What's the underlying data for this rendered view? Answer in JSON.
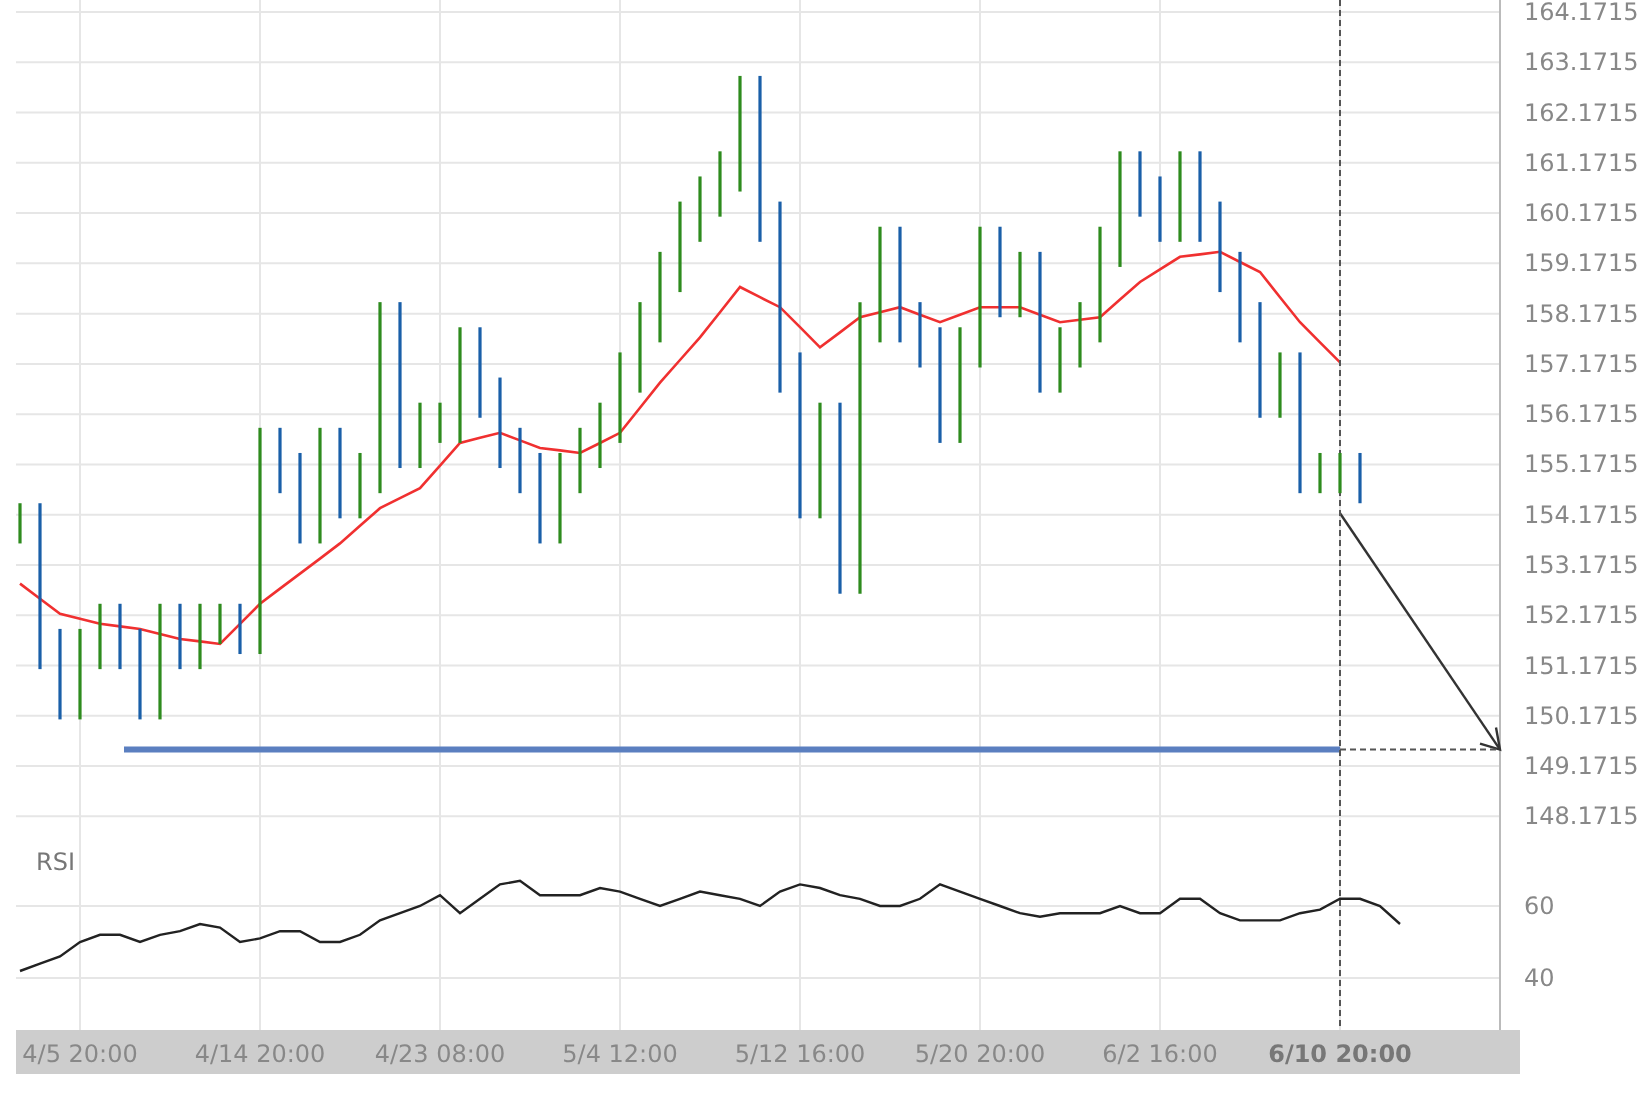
{
  "price_chart": {
    "chart_data": {
      "type": "line",
      "grid": true,
      "ylim": [
        147.9,
        164.41
      ],
      "categories": [
        null,
        null,
        null,
        null,
        null,
        null,
        null,
        null,
        null,
        null,
        null,
        null,
        null,
        null,
        null,
        null,
        null,
        null,
        null,
        null,
        null,
        null,
        null,
        null,
        null,
        null,
        null,
        null,
        null,
        null,
        null,
        null,
        null,
        null,
        null,
        null,
        null,
        null,
        null,
        null,
        null,
        null,
        null,
        null,
        null,
        null,
        null,
        null,
        null,
        null,
        null,
        null,
        null,
        null,
        null,
        null,
        null,
        null,
        null,
        null,
        null,
        null,
        null,
        null,
        null,
        null,
        null
      ],
      "yticks": [
        {
          "value": 164.1715,
          "label": "164.1715"
        },
        {
          "value": 163.1715,
          "label": "163.1715"
        },
        {
          "value": 162.1715,
          "label": "162.1715"
        },
        {
          "value": 161.1715,
          "label": "161.1715"
        },
        {
          "value": 160.1715,
          "label": "160.1715"
        },
        {
          "value": 159.1715,
          "label": "159.1715"
        },
        {
          "value": 158.1715,
          "label": "158.1715"
        },
        {
          "value": 157.1715,
          "label": "157.1715"
        },
        {
          "value": 156.1715,
          "label": "156.1715"
        },
        {
          "value": 155.1715,
          "label": "155.1715"
        },
        {
          "value": 154.1715,
          "label": "154.1715"
        },
        {
          "value": 153.1715,
          "label": "153.1715"
        },
        {
          "value": 152.1715,
          "label": "152.1715"
        },
        {
          "value": 151.1715,
          "label": "151.1715"
        },
        {
          "value": 150.1715,
          "label": "150.1715"
        },
        {
          "value": 149.1715,
          "label": "149.1715"
        },
        {
          "value": 148.1715,
          "label": "148.1715"
        }
      ],
      "series": [
        {
          "color": "#f03030",
          "values": [
            152.8,
            152.5,
            152.2,
            152.1,
            152,
            151.95,
            151.9,
            151.8,
            151.7,
            151.65,
            151.6,
            152,
            152.4,
            152.7,
            153,
            153.3,
            153.6,
            153.95,
            154.3,
            154.5,
            154.7,
            155.15,
            155.6,
            155.7,
            155.8,
            155.65,
            155.5,
            155.45,
            155.4,
            155.6,
            155.8,
            156.3,
            156.8,
            157.25,
            157.7,
            158.2,
            158.7,
            158.5,
            158.3,
            157.9,
            157.5,
            157.8,
            158.1,
            158.2,
            158.3,
            158.15,
            158,
            158.15,
            158.3,
            158.3,
            158.3,
            158.15,
            158,
            158.05,
            158.1,
            158.45,
            158.8,
            159.05,
            159.3,
            159.35,
            159.4,
            159.2,
            159,
            158.5,
            158,
            157.6,
            157.2
          ]
        }
      ],
      "ref_lines": [
        {
          "axis": "y",
          "value": 149.5,
          "color": "#5b7fc0"
        }
      ]
    }
  },
  "rsi_chart": {
    "chart_data": {
      "type": "line",
      "title": "RSI",
      "grid": true,
      "ylim": [
        25.6,
        81.1
      ],
      "categories": [
        null,
        null,
        null,
        "4/5 20:00",
        null,
        null,
        null,
        null,
        null,
        null,
        null,
        null,
        "4/14 20:00",
        null,
        null,
        null,
        null,
        null,
        null,
        null,
        null,
        "4/23 08:00",
        null,
        null,
        null,
        null,
        null,
        null,
        null,
        null,
        "5/4 12:00",
        null,
        null,
        null,
        null,
        null,
        null,
        null,
        null,
        "5/12 16:00",
        null,
        null,
        null,
        null,
        null,
        null,
        null,
        null,
        "5/20 20:00",
        null,
        null,
        null,
        null,
        null,
        null,
        null,
        null,
        "6/2 16:00",
        null,
        null,
        null,
        null,
        null,
        null,
        null,
        null,
        "6/10 20:00",
        null,
        null,
        null
      ],
      "yticks": [
        60,
        40
      ],
      "series": [
        {
          "color": "#222222",
          "values": [
            42,
            44,
            46,
            50,
            52,
            52,
            50,
            52,
            53,
            55,
            54,
            50,
            51,
            53,
            53,
            50,
            50,
            52,
            56,
            58,
            60,
            63,
            58,
            62,
            66,
            67,
            63,
            63,
            63,
            65,
            64,
            62,
            60,
            62,
            64,
            63,
            62,
            60,
            64,
            66,
            65,
            63,
            62,
            60,
            60,
            62,
            66,
            64,
            62,
            60,
            58,
            57,
            58,
            58,
            58,
            60,
            58,
            58,
            62,
            62,
            58,
            56,
            56,
            56,
            58,
            59,
            62,
            62,
            60,
            55
          ]
        }
      ]
    }
  }
}
